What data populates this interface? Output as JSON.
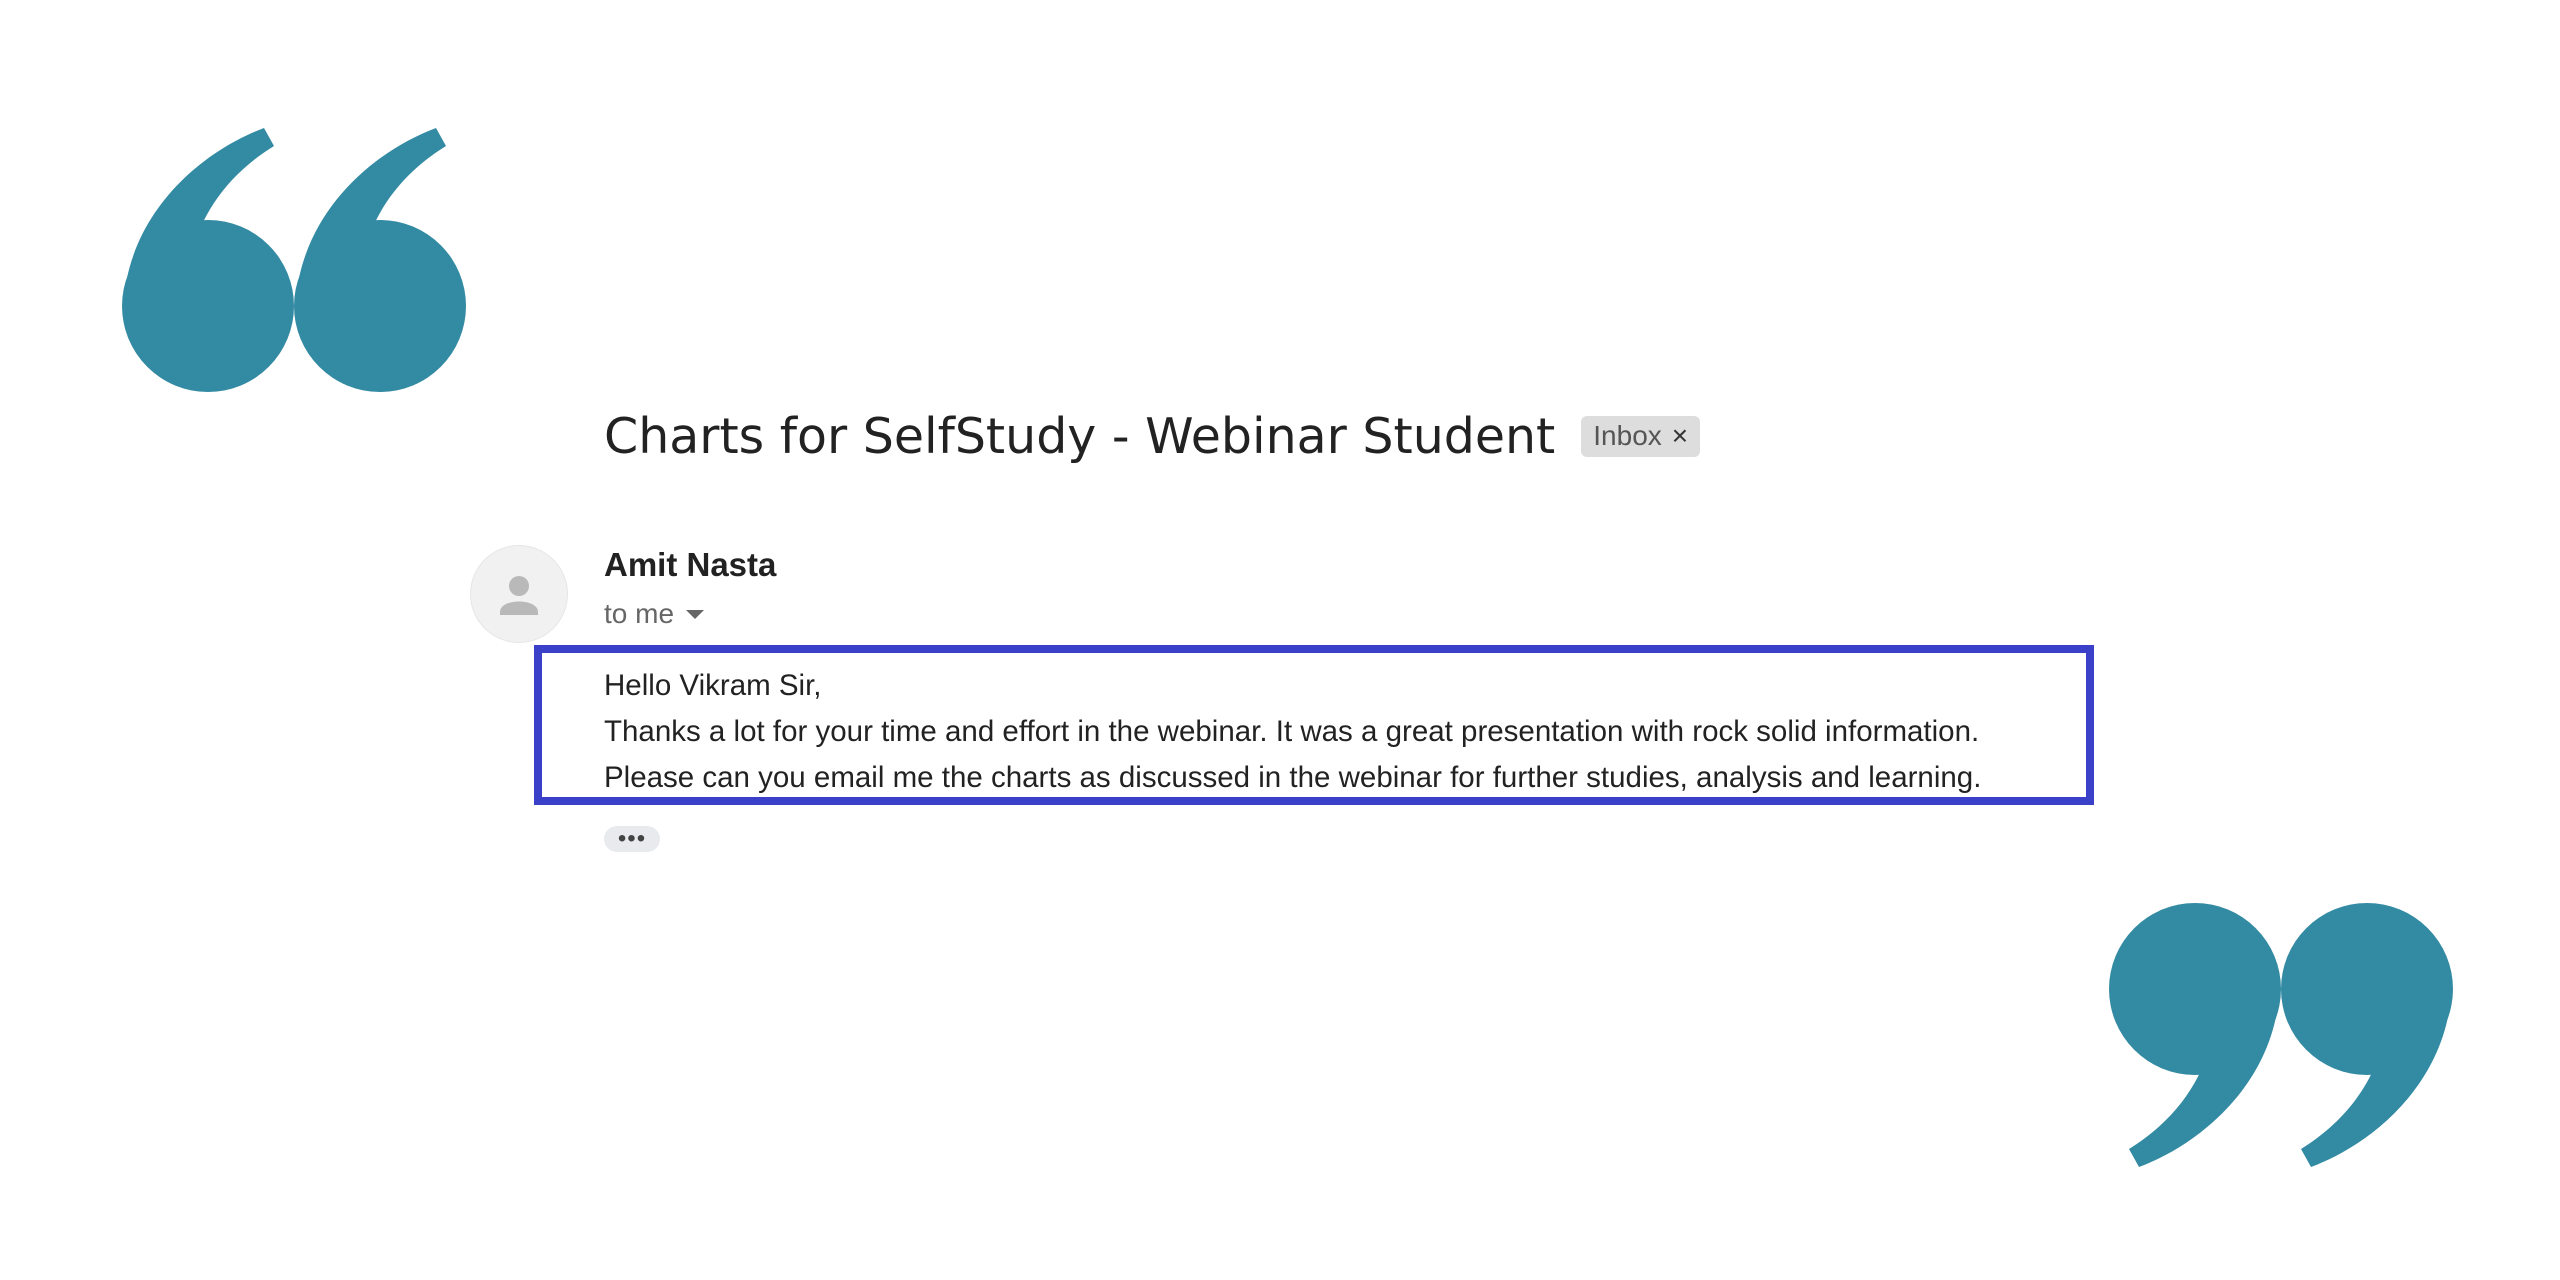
{
  "email": {
    "subject": "Charts for SelfStudy - Webinar Student",
    "label": {
      "text": "Inbox",
      "remove_glyph": "×"
    },
    "sender": {
      "name": "Amit Nasta",
      "recipient_text": "to me",
      "avatar_icon": "person-icon"
    },
    "body_lines": [
      "Hello Vikram Sir,",
      "Thanks a lot for your time and effort in the webinar. It was a great presentation with rock solid information.",
      "Please can you email me the charts as discussed in the webinar for further studies, analysis and learning."
    ],
    "more_button": "•••"
  },
  "decor": {
    "quote_color": "#338aa3",
    "highlight_color": "#3b40c9",
    "open_quote_icon": "open-quote-icon",
    "close_quote_icon": "close-quote-icon"
  }
}
